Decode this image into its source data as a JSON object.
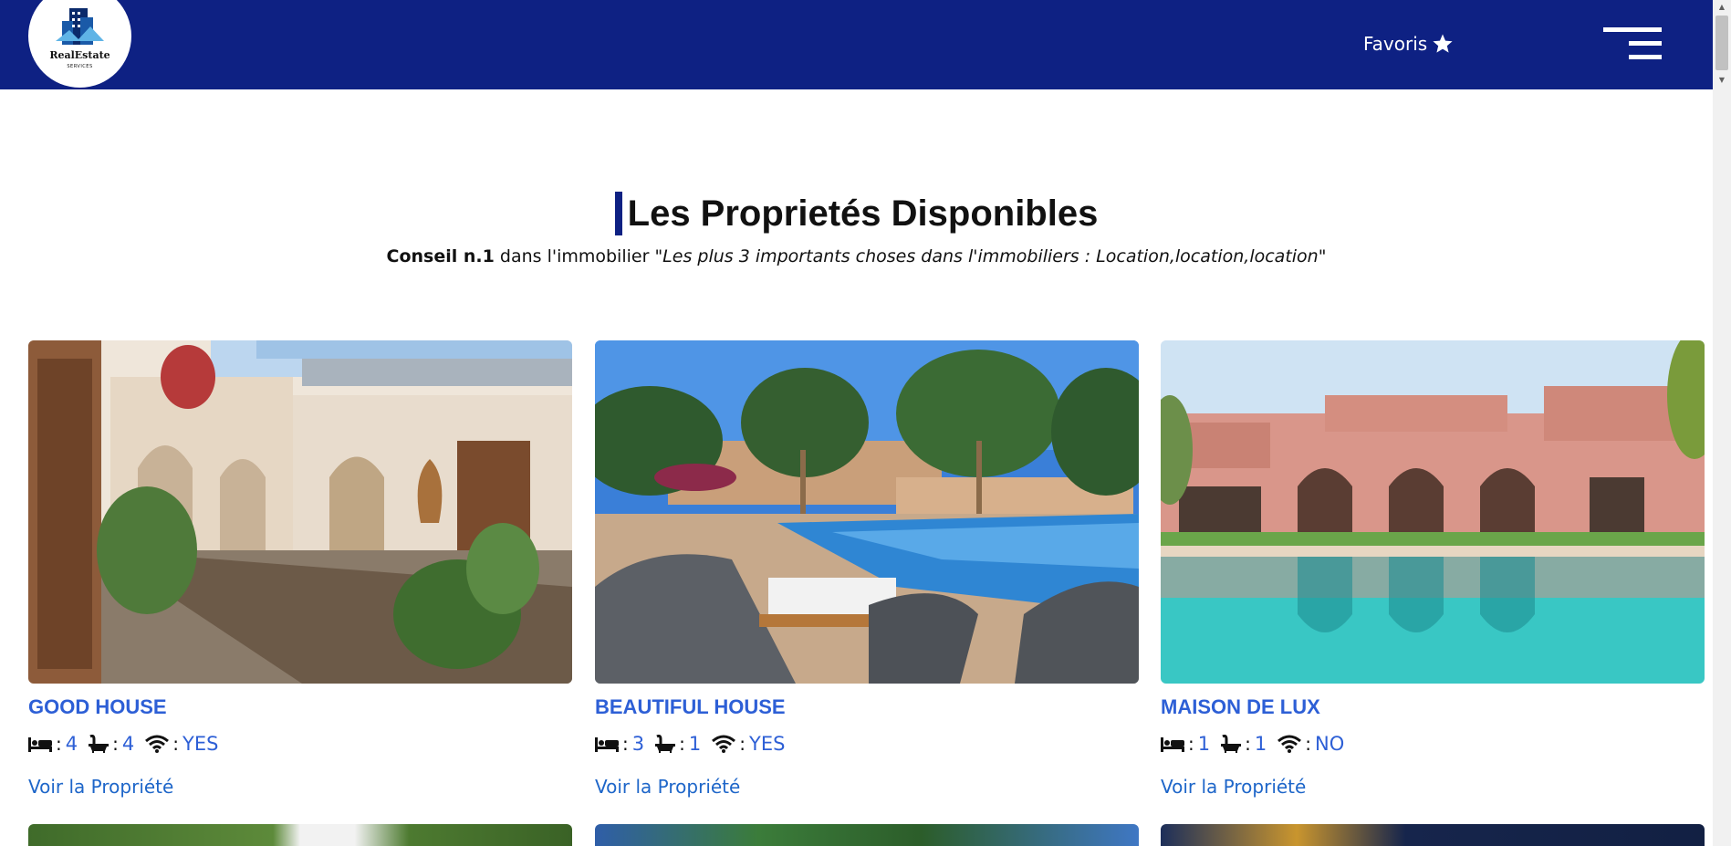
{
  "header": {
    "logo_name": "RealEstate",
    "logo_sub": "SERVICES",
    "favorites_label": "Favoris"
  },
  "section": {
    "title": "Les Proprietés Disponibles",
    "subtitle_bold": "Conseil n.1",
    "subtitle_text": " dans l'immobilier ",
    "subtitle_quote": "\"Les plus 3 importants choses dans l'immobiliers : Location,location,location\""
  },
  "cards": [
    {
      "title": "GOOD HOUSE",
      "beds": "4",
      "baths": "4",
      "wifi": "YES",
      "link_label": "Voir la Propriété"
    },
    {
      "title": "BEAUTIFUL HOUSE",
      "beds": "3",
      "baths": "1",
      "wifi": "YES",
      "link_label": "Voir la Propriété"
    },
    {
      "title": "MAISON DE LUX",
      "beds": "1",
      "baths": "1",
      "wifi": "NO",
      "link_label": "Voir la Propriété"
    }
  ],
  "feature_separator": ":",
  "colors": {
    "navbar": "#0e2183",
    "title_blue": "#2d5fd6",
    "link_blue": "#1e66c9"
  },
  "icons": [
    "star-icon",
    "hamburger-menu-icon",
    "bed-icon",
    "bath-icon",
    "wifi-icon",
    "buildings-logo-icon"
  ]
}
